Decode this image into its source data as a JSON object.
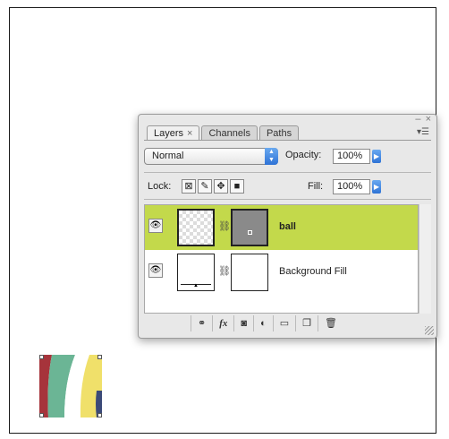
{
  "panel": {
    "tabs": [
      "Layers",
      "Channels",
      "Paths"
    ],
    "active_tab": "Layers",
    "tab_close_glyph": "×",
    "window_controls": [
      "–",
      "×"
    ],
    "blend_mode": "Normal",
    "opacity_label": "Opacity:",
    "opacity_value": "100%",
    "lock_label": "Lock:",
    "fill_label": "Fill:",
    "fill_value": "100%",
    "layers": [
      {
        "name": "ball",
        "selected": true,
        "visible": true
      },
      {
        "name": "Background Fill",
        "selected": false,
        "visible": true
      }
    ],
    "bottom_icons": [
      "link-icon",
      "fx-icon",
      "mask-icon",
      "adjustment-icon",
      "folder-icon",
      "new-layer-icon",
      "trash-icon"
    ],
    "fx_label": "fx"
  },
  "colors": {
    "selected_row": "#c3d94b",
    "art_red": "#a6343b",
    "art_green": "#6bb595",
    "art_yellow": "#f0e06a",
    "art_navy": "#3b4a78"
  }
}
